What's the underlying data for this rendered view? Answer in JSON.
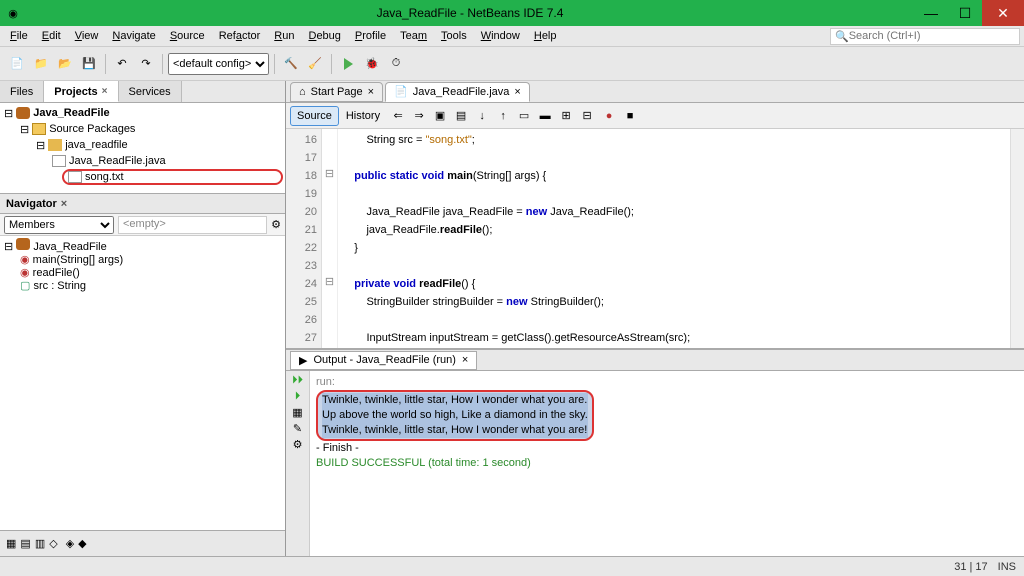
{
  "window": {
    "title": "Java_ReadFile - NetBeans IDE 7.4"
  },
  "menu": [
    "File",
    "Edit",
    "View",
    "Navigate",
    "Source",
    "Refactor",
    "Run",
    "Debug",
    "Profile",
    "Team",
    "Tools",
    "Window",
    "Help"
  ],
  "search_placeholder": "Search (Ctrl+I)",
  "config": "<default config>",
  "left_tabs": {
    "files": "Files",
    "projects": "Projects",
    "services": "Services"
  },
  "project_tree": {
    "root": "Java_ReadFile",
    "src_pkg": "Source Packages",
    "pkg": "java_readfile",
    "file1": "Java_ReadFile.java",
    "file2": "song.txt"
  },
  "navigator_title": "Navigator",
  "members_label": "Members",
  "empty_label": "<empty>",
  "nav_tree": {
    "cls": "Java_ReadFile",
    "m1": "main(String[] args)",
    "m2": "readFile()",
    "f1": "src : String"
  },
  "editor_tabs": {
    "start": "Start Page",
    "java": "Java_ReadFile.java"
  },
  "editor_mode": {
    "source": "Source",
    "history": "History"
  },
  "code_lines": [
    {
      "n": "16",
      "t": "        String src = \"song.txt\";"
    },
    {
      "n": "17",
      "t": ""
    },
    {
      "n": "18",
      "t": "    public static void main(String[] args) {",
      "fold": "⊟"
    },
    {
      "n": "19",
      "t": ""
    },
    {
      "n": "20",
      "t": "        Java_ReadFile java_ReadFile = new Java_ReadFile();"
    },
    {
      "n": "21",
      "t": "        java_ReadFile.readFile();"
    },
    {
      "n": "22",
      "t": "    }"
    },
    {
      "n": "23",
      "t": ""
    },
    {
      "n": "24",
      "t": "    private void readFile() {",
      "fold": "⊟"
    },
    {
      "n": "25",
      "t": "        StringBuilder stringBuilder = new StringBuilder();"
    },
    {
      "n": "26",
      "t": ""
    },
    {
      "n": "27",
      "t": "        InputStream inputStream = getClass().getResourceAsStream(src);"
    }
  ],
  "output_title": "Output - Java_ReadFile (run)",
  "output": {
    "run": "run:",
    "l1": "Twinkle, twinkle, little star, How I wonder what you are.",
    "l2": "Up above the world so high, Like a diamond in the sky.",
    "l3": "Twinkle, twinkle, little star, How I wonder what you are!",
    "finish": "- Finish -",
    "build": "BUILD SUCCESSFUL (total time: 1 second)"
  },
  "status": {
    "pos": "31 | 17",
    "ins": "INS"
  }
}
